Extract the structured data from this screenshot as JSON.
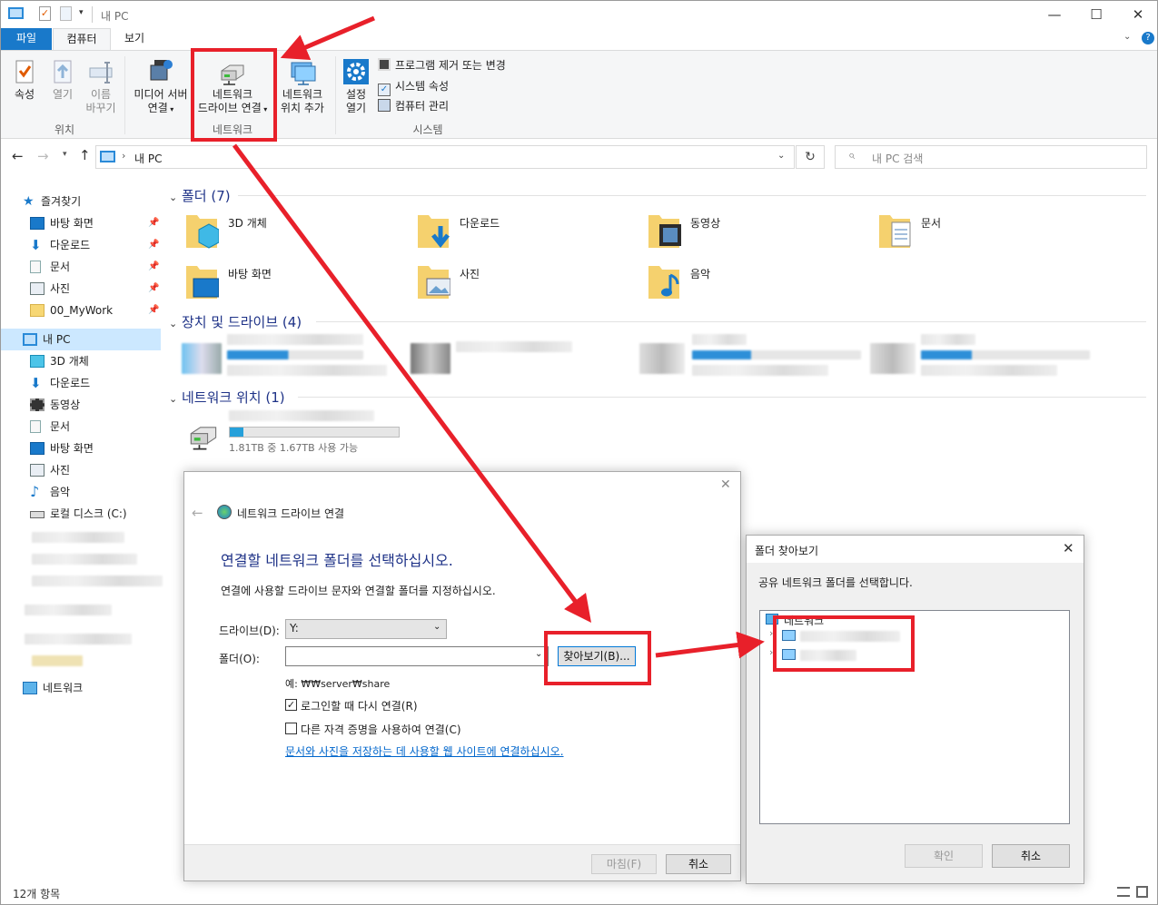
{
  "window": {
    "title": "내 PC"
  },
  "ribbon": {
    "tabs": {
      "file": "파일",
      "computer": "컴퓨터",
      "view": "보기"
    },
    "location": {
      "properties": "속성",
      "open": "열기",
      "rename_1": "이름",
      "rename_2": "바꾸기",
      "label": "위치"
    },
    "network": {
      "media_1": "미디어 서버",
      "media_2": "연결",
      "map_1": "네트워크",
      "map_2": "드라이브 연결",
      "add_1": "네트워크",
      "add_2": "위치 추가",
      "label": "네트워크"
    },
    "system": {
      "settings_1": "설정",
      "settings_2": "열기",
      "uninstall": "프로그램 제거 또는 변경",
      "sysprops": "시스템 속성",
      "manage": "컴퓨터 관리",
      "label": "시스템"
    }
  },
  "address": {
    "crumb": "내 PC",
    "search_placeholder": "내 PC 검색"
  },
  "nav": {
    "quick": "즐겨찾기",
    "quick_items": [
      "바탕 화면",
      "다운로드",
      "문서",
      "사진",
      "00_MyWork"
    ],
    "this_pc": "내 PC",
    "pc_items": [
      "3D 개체",
      "다운로드",
      "동영상",
      "문서",
      "바탕 화면",
      "사진",
      "음악",
      "로컬 디스크 (C:)"
    ],
    "network": "네트워크"
  },
  "content": {
    "folders_header": "폴더 (7)",
    "folders": [
      "3D 개체",
      "다운로드",
      "동영상",
      "문서",
      "바탕 화면",
      "사진",
      "음악"
    ],
    "devices_header": "장치 및 드라이브 (4)",
    "netloc_header": "네트워크 위치 (1)",
    "netloc_size": "1.81TB 중 1.67TB 사용 가능",
    "netloc_usage": 0.08
  },
  "status": {
    "items": "12개 항목"
  },
  "map_dialog": {
    "title": "네트워크 드라이브 연결",
    "heading": "연결할 네트워크 폴더를 선택하십시오.",
    "desc": "연결에 사용할 드라이브 문자와 연결할 폴더를 지정하십시오.",
    "drive_label": "드라이브(D):",
    "drive_value": "Y:",
    "folder_label": "폴더(O):",
    "folder_value": "",
    "browse": "찾아보기(B)...",
    "example": "예: ₩₩server₩share",
    "reconnect": "로그인할 때 다시 연결(R)",
    "reconnect_checked": true,
    "other_creds": "다른 자격 증명을 사용하여 연결(C)",
    "other_creds_checked": false,
    "link": "문서와 사진을 저장하는 데 사용할 웹 사이트에 연결하십시오.",
    "finish": "마침(F)",
    "cancel": "취소"
  },
  "browse_dialog": {
    "title": "폴더 찾아보기",
    "desc": "공유 네트워크 폴더를 선택합니다.",
    "root": "네트워크",
    "ok": "확인",
    "cancel": "취소"
  },
  "colors": {
    "accent": "#1979ca",
    "highlight": "#e8202a",
    "link": "#0066cc",
    "heading": "#1e3287"
  }
}
